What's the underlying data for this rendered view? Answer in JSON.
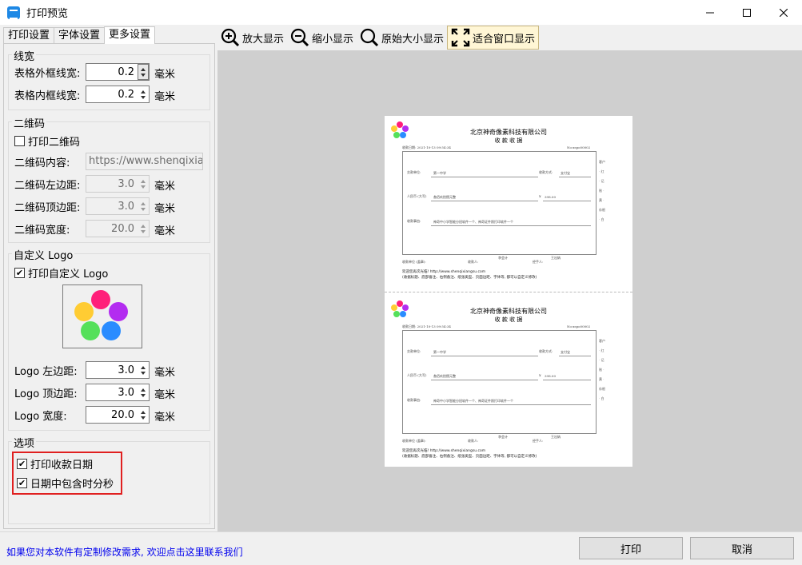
{
  "window": {
    "title": "打印预览"
  },
  "tabs": [
    {
      "label": "打印设置"
    },
    {
      "label": "字体设置"
    },
    {
      "label": "更多设置"
    }
  ],
  "line_width": {
    "legend": "线宽",
    "outer_label": "表格外框线宽:",
    "outer_value": "0.2",
    "inner_label": "表格内框线宽:",
    "inner_value": "0.2",
    "unit": "毫米"
  },
  "qrcode": {
    "legend": "二维码",
    "print_label": "打印二维码",
    "print_checked": false,
    "content_label": "二维码内容:",
    "content_value": "https://www.shenqixiangsu",
    "left_label": "二维码左边距:",
    "left_value": "3.0",
    "top_label": "二维码顶边距:",
    "top_value": "3.0",
    "width_label": "二维码宽度:",
    "width_value": "20.0",
    "unit": "毫米"
  },
  "logo": {
    "legend": "自定义 Logo",
    "print_label": "打印自定义 Logo",
    "print_checked": true,
    "left_label": "Logo 左边距:",
    "left_value": "3.0",
    "top_label": "Logo 顶边距:",
    "top_value": "3.0",
    "width_label": "Logo 宽度:",
    "width_value": "20.0",
    "unit": "毫米",
    "colors": [
      "#ff1f7a",
      "#b32cf0",
      "#ffcc33",
      "#55e05a",
      "#2a8cff"
    ]
  },
  "options": {
    "legend": "选项",
    "print_date_label": "打印收款日期",
    "print_date_checked": true,
    "include_time_label": "日期中包含时分秒",
    "include_time_checked": true
  },
  "toolbar": {
    "zoom_in": "放大显示",
    "zoom_out": "缩小显示",
    "actual_size": "原始大小显示",
    "fit_window": "适合窗口显示"
  },
  "receipt": {
    "company": "北京神奇像素科技有限公司",
    "doc_title": "收 款 收 据",
    "date_text": "收款日期: 2021-10-13 09:54:34",
    "number_text": "No:xspo00002",
    "payer_label": "交款单位:",
    "payer_value": "第一中学",
    "method_label": "收款方式:",
    "method_value": "支付宝",
    "amount_cn_label": "人民币 (大写)",
    "amount_cn_value": "叁佰玖拾捌元整",
    "amount_symbol": "¥",
    "amount_value": "398.00",
    "reason_label": "收款事由:",
    "reason_value": "神奇中小学智能分班软件一个、神奇证件照打印软件一个",
    "accountant": "李会计",
    "manager": "王出纳",
    "unit_label": "收款单位 (盖章):",
    "receiver_label": "收款人:",
    "handler_label": "经手人:",
    "side_text": "客户 · 红 · 记账 · 黄 · 存根 · 白",
    "footer1": "欢迎您再次光临! http://www.shenqixiangsu.com",
    "footer2": "(收据标题、底部备注、右侧备注、纸张类型、页面边距、字体等, 都可以自定义修改)"
  },
  "status": {
    "contact": "如果您对本软件有定制修改需求, 欢迎点击这里联系我们",
    "print_button": "打印",
    "cancel_button": "取消"
  }
}
